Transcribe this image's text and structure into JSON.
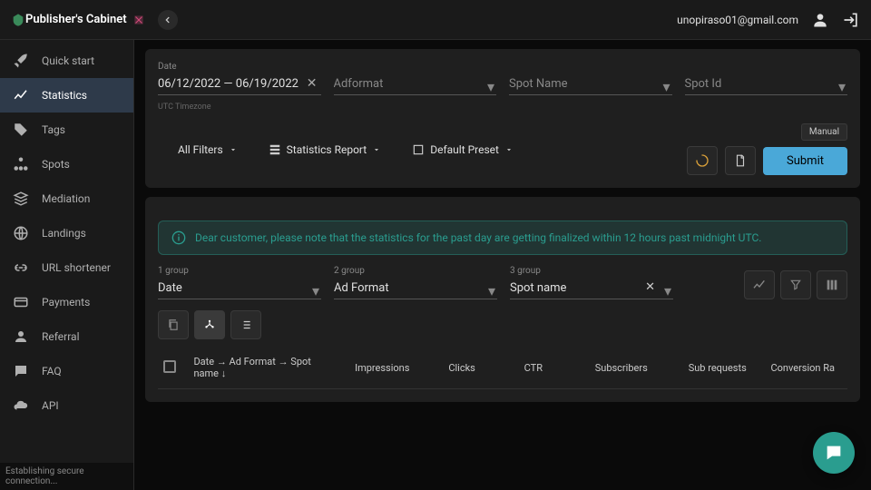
{
  "header": {
    "app_title": "Publisher's Cabinet",
    "user_email": "unopiraso01@gmail.com"
  },
  "sidebar": {
    "items": [
      {
        "label": "Quick start"
      },
      {
        "label": "Statistics"
      },
      {
        "label": "Tags"
      },
      {
        "label": "Spots"
      },
      {
        "label": "Mediation"
      },
      {
        "label": "Landings"
      },
      {
        "label": "URL shortener"
      },
      {
        "label": "Payments"
      },
      {
        "label": "Referral"
      },
      {
        "label": "FAQ"
      },
      {
        "label": "API"
      }
    ]
  },
  "status_text": "Establishing secure connection...",
  "filters": {
    "date_label": "Date",
    "date_value": "06/12/2022 — 06/19/2022",
    "date_helper": "UTC Timezone",
    "adformat_placeholder": "Adformat",
    "spotname_placeholder": "Spot Name",
    "spotid_placeholder": "Spot Id"
  },
  "actions": {
    "all_filters": "All Filters",
    "stats_report": "Statistics Report",
    "default_preset": "Default Preset",
    "manual": "Manual",
    "submit": "Submit"
  },
  "notice": "Dear customer, please note that the statistics for the past day are getting finalized within 12 hours past midnight UTC.",
  "groups": {
    "g1_label": "1 group",
    "g1_value": "Date",
    "g2_label": "2 group",
    "g2_value": "Ad Format",
    "g3_label": "3 group",
    "g3_value": "Spot name"
  },
  "table": {
    "columns": {
      "hierarchy": "Date → Ad Format → Spot name ↓",
      "impressions": "Impressions",
      "clicks": "Clicks",
      "ctr": "CTR",
      "subscribers": "Subscribers",
      "sub_requests": "Sub requests",
      "conversion": "Conversion Ra"
    }
  }
}
